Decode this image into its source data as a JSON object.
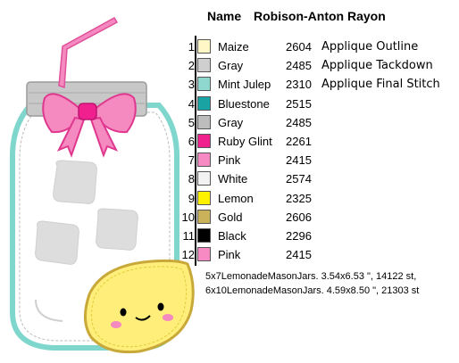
{
  "header": {
    "name_label": "Name",
    "thread_brand": "Robison-Anton Rayon"
  },
  "colors": [
    {
      "num": "1",
      "swatch": "#fff8c6",
      "name": "Maize",
      "code": "2604",
      "step": "Applique Outline"
    },
    {
      "num": "2",
      "swatch": "#cfcfcf",
      "name": "Gray",
      "code": "2485",
      "step": "Applique Tackdown"
    },
    {
      "num": "3",
      "swatch": "#8fd8d0",
      "name": "Mint Julep",
      "code": "2310",
      "step": "Applique Final Stitch"
    },
    {
      "num": "4",
      "swatch": "#1aa3a3",
      "name": "Bluestone",
      "code": "2515",
      "step": ""
    },
    {
      "num": "5",
      "swatch": "#bdbdbd",
      "name": "Gray",
      "code": "2485",
      "step": ""
    },
    {
      "num": "6",
      "swatch": "#f0218f",
      "name": "Ruby Glint",
      "code": "2261",
      "step": ""
    },
    {
      "num": "7",
      "swatch": "#f78ac2",
      "name": "Pink",
      "code": "2415",
      "step": ""
    },
    {
      "num": "8",
      "swatch": "#f2f2f2",
      "name": "White",
      "code": "2574",
      "step": ""
    },
    {
      "num": "9",
      "swatch": "#fff200",
      "name": "Lemon",
      "code": "2325",
      "step": ""
    },
    {
      "num": "10",
      "swatch": "#c9b25a",
      "name": "Gold",
      "code": "2606",
      "step": ""
    },
    {
      "num": "11",
      "swatch": "#000000",
      "name": "Black",
      "code": "2296",
      "step": ""
    },
    {
      "num": "12",
      "swatch": "#f78ac2",
      "name": "Pink",
      "code": "2415",
      "step": ""
    }
  ],
  "files": [
    "5x7LemonadeMasonJars. 3.54x6.53 \", 14122 st,",
    "6x10LemonadeMasonJars. 4.59x8.50 \", 21303 st"
  ],
  "artwork": {
    "icon": "lemonade-mason-jar-icon"
  }
}
